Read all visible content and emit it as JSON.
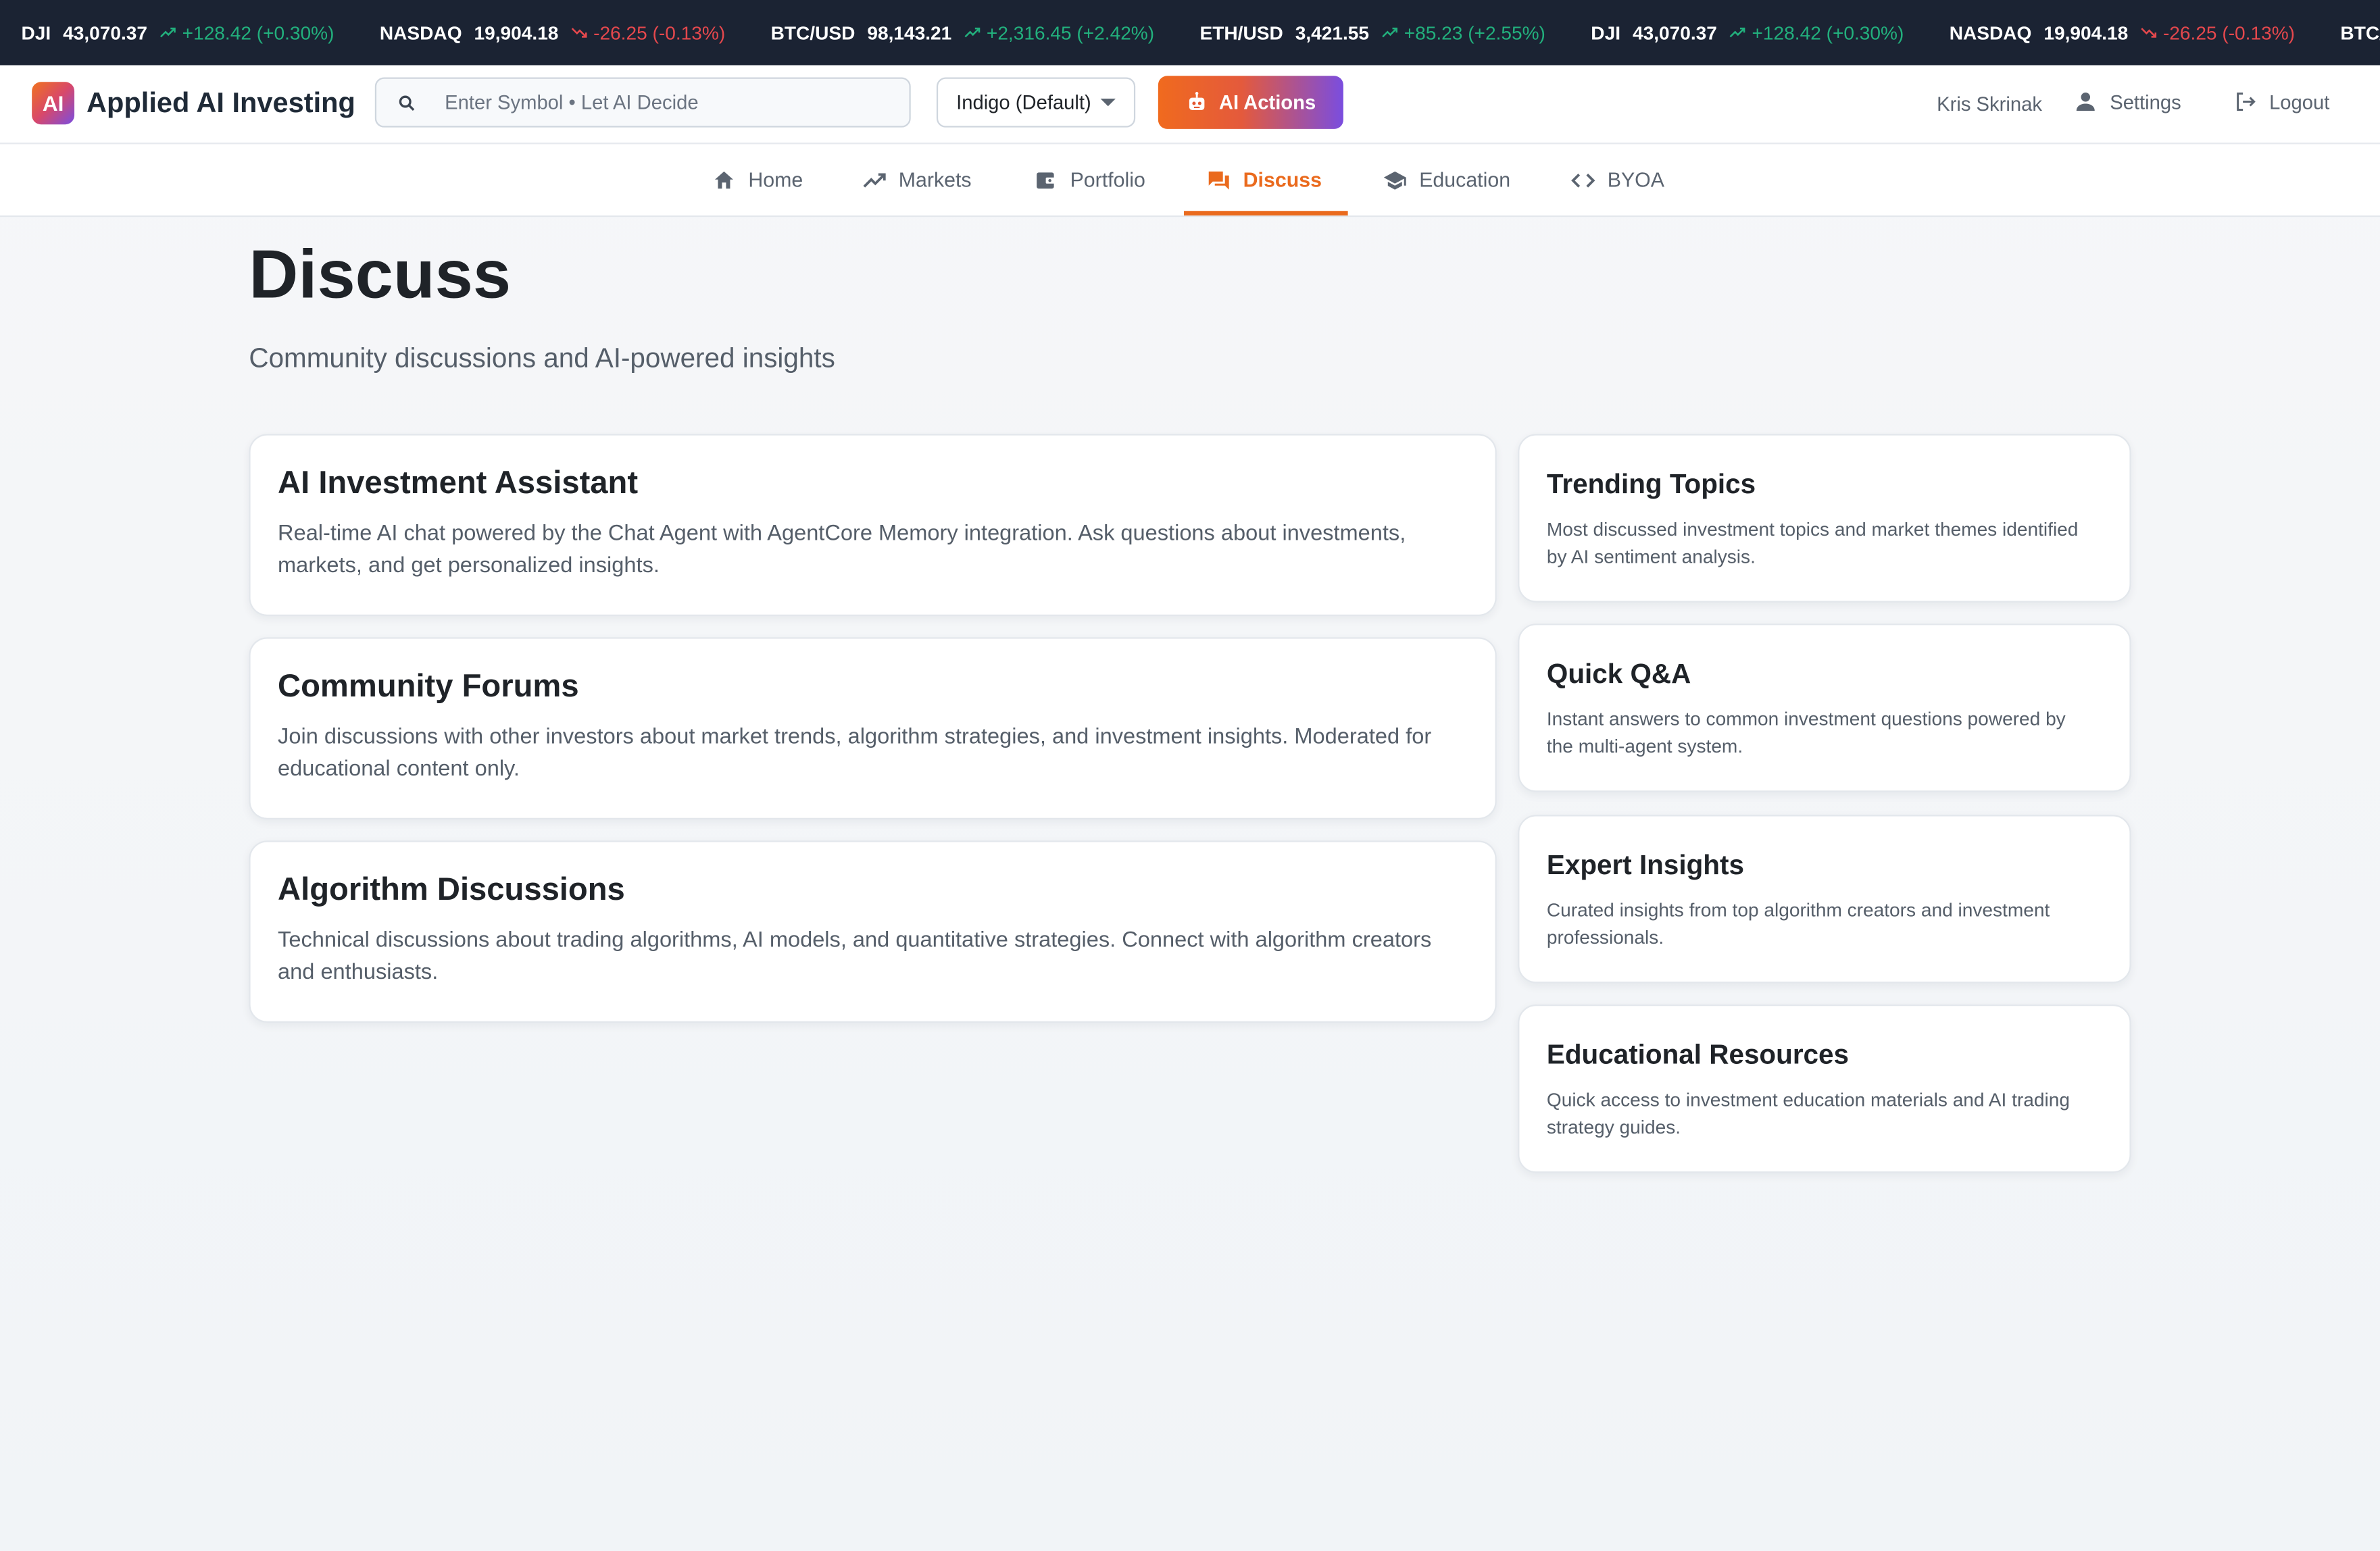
{
  "ticker": [
    {
      "symbol": "DJI",
      "price": "43,070.37",
      "change": "+128.42 (+0.30%)",
      "direction": "up"
    },
    {
      "symbol": "NASDAQ",
      "price": "19,904.18",
      "change": "-26.25 (-0.13%)",
      "direction": "down"
    },
    {
      "symbol": "BTC/USD",
      "price": "98,143.21",
      "change": "+2,316.45 (+2.42%)",
      "direction": "up"
    },
    {
      "symbol": "ETH/USD",
      "price": "3,421.55",
      "change": "+85.23 (+2.55%)",
      "direction": "up"
    },
    {
      "symbol": "DJI",
      "price": "43,070.37",
      "change": "+128.42 (+0.30%)",
      "direction": "up"
    },
    {
      "symbol": "NASDAQ",
      "price": "19,904.18",
      "change": "-26.25 (-0.13%)",
      "direction": "down"
    },
    {
      "symbol": "BTC/USD",
      "price": "",
      "change": "",
      "direction": "up"
    }
  ],
  "colors": {
    "up": "#22b07d",
    "down": "#e5484d",
    "accent": "#ea6a1d",
    "ticker_bg": "#1b2333"
  },
  "header": {
    "logo_text": "AI",
    "app_title": "Applied AI Investing",
    "search_placeholder": "Enter Symbol • Let AI Decide",
    "theme_selected": "Indigo (Default)",
    "ai_actions_label": "AI Actions",
    "user_name": "Kris Skrinak",
    "settings_label": "Settings",
    "logout_label": "Logout"
  },
  "nav": {
    "items": [
      {
        "label": "Home",
        "icon": "home-icon"
      },
      {
        "label": "Markets",
        "icon": "trending-up-icon"
      },
      {
        "label": "Portfolio",
        "icon": "wallet-icon"
      },
      {
        "label": "Discuss",
        "icon": "chat-icon",
        "active": true
      },
      {
        "label": "Education",
        "icon": "graduation-cap-icon"
      },
      {
        "label": "BYOA",
        "icon": "code-icon"
      }
    ]
  },
  "main": {
    "title": "Discuss",
    "subtitle": "Community discussions and AI-powered insights",
    "primary_cards": [
      {
        "title": "AI Investment Assistant",
        "description": "Real-time AI chat powered by the Chat Agent with AgentCore Memory integration. Ask questions about investments, markets, and get personalized insights."
      },
      {
        "title": "Community Forums",
        "description": "Join discussions with other investors about market trends, algorithm strategies, and investment insights. Moderated for educational content only."
      },
      {
        "title": "Algorithm Discussions",
        "description": "Technical discussions about trading algorithms, AI models, and quantitative strategies. Connect with algorithm creators and enthusiasts."
      }
    ],
    "side_cards": [
      {
        "title": "Trending Topics",
        "description": "Most discussed investment topics and market themes identified by AI sentiment analysis."
      },
      {
        "title": "Quick Q&A",
        "description": "Instant answers to common investment questions powered by the multi-agent system."
      },
      {
        "title": "Expert Insights",
        "description": "Curated insights from top algorithm creators and investment professionals."
      },
      {
        "title": "Educational Resources",
        "description": "Quick access to investment education materials and AI trading strategy guides."
      }
    ]
  }
}
